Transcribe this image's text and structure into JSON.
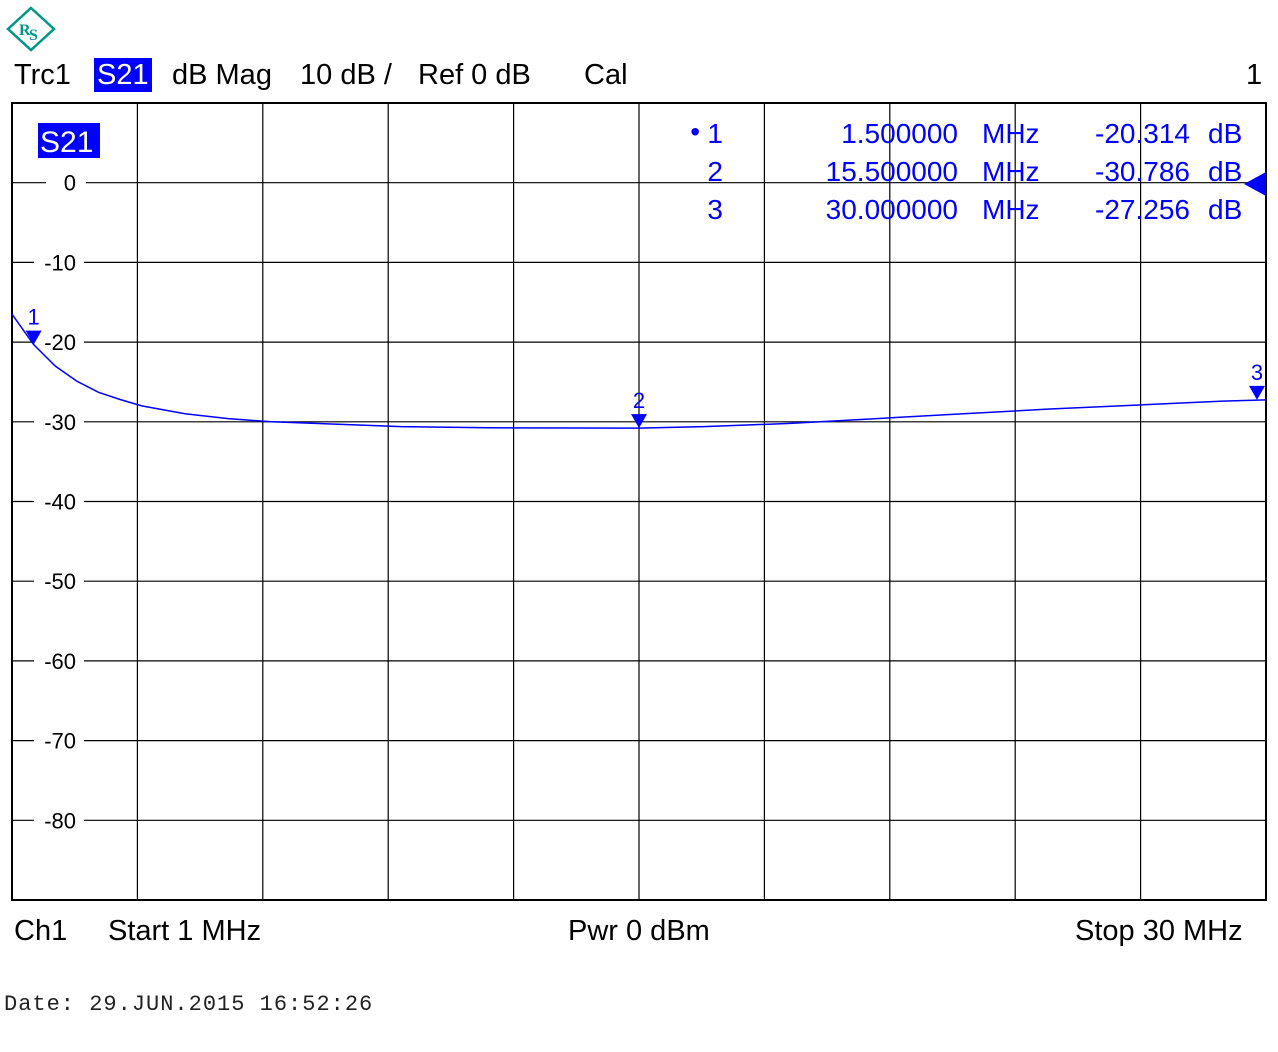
{
  "header": {
    "trace": "Trc1",
    "param": "S21",
    "format": "dB Mag",
    "scale": "10 dB /",
    "ref": "Ref 0 dB",
    "cal": "Cal",
    "window_no": "1"
  },
  "footer": {
    "channel": "Ch1",
    "start": "Start  1 MHz",
    "power": "Pwr  0 dBm",
    "stop": "Stop  30 MHz"
  },
  "date_line": "Date: 29.JUN.2015  16:52:26",
  "logo_name": "rohde-schwarz-logo",
  "colors": {
    "trace": "#0000ff",
    "grid": "#000000",
    "background": "#ffffff"
  },
  "chart_data": {
    "type": "line",
    "trace_label": "S21",
    "x_unit": "MHz",
    "y_unit": "dB",
    "xlim": [
      1,
      30
    ],
    "ylim": [
      -90,
      10
    ],
    "x_divisions": 10,
    "y_ticks": [
      0,
      -10,
      -20,
      -30,
      -40,
      -50,
      -60,
      -70,
      -80
    ],
    "y_tick_labels": [
      "0",
      "-10",
      "-20",
      "-30",
      "-40",
      "-50",
      "-60",
      "-70",
      "-80"
    ],
    "grid": true,
    "reference_level": 0,
    "series": [
      {
        "x": [
          1.0,
          1.5,
          2.0,
          2.5,
          3.0,
          3.5,
          4.0,
          5.0,
          6.0,
          7.0,
          8.0,
          9.0,
          10.0,
          12.0,
          14.0,
          15.5,
          17.0,
          19.0,
          21.0,
          23.0,
          25.0,
          27.0,
          29.0,
          30.0
        ],
        "y": [
          -16.5,
          -20.3,
          -23.0,
          -24.9,
          -26.3,
          -27.2,
          -28.0,
          -29.0,
          -29.6,
          -30.0,
          -30.2,
          -30.4,
          -30.6,
          -30.75,
          -30.78,
          -30.786,
          -30.6,
          -30.2,
          -29.6,
          -29.0,
          -28.4,
          -27.9,
          -27.4,
          -27.256
        ]
      }
    ],
    "markers": [
      {
        "id": "1",
        "active_symbol": "•",
        "freq": "1.500000",
        "freq_unit": "MHz",
        "value": "-20.314",
        "value_unit": "dB",
        "x": 1.5,
        "y": -20.314
      },
      {
        "id": "2",
        "active_symbol": "",
        "freq": "15.500000",
        "freq_unit": "MHz",
        "value": "-30.786",
        "value_unit": "dB",
        "x": 15.5,
        "y": -30.786
      },
      {
        "id": "3",
        "active_symbol": "",
        "freq": "30.000000",
        "freq_unit": "MHz",
        "value": "-27.256",
        "value_unit": "dB",
        "x": 30.0,
        "y": -27.256
      }
    ]
  }
}
